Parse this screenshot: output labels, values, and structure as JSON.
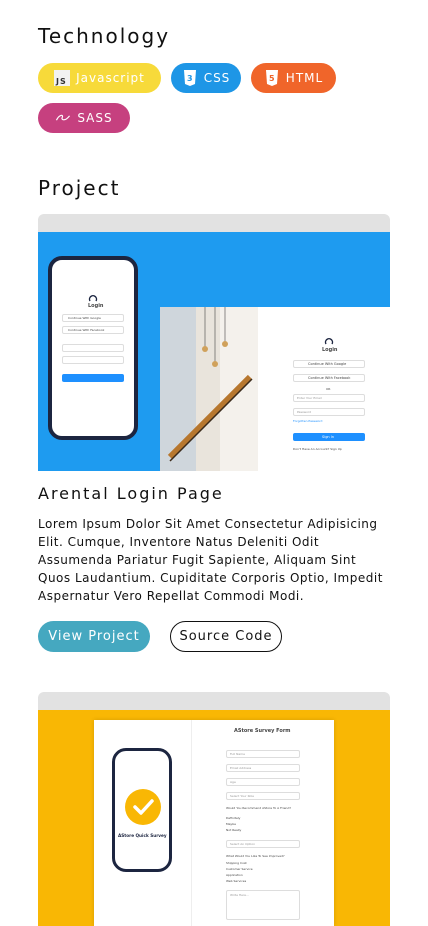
{
  "technology": {
    "title": "Technology",
    "badges": [
      {
        "label": "Javascript",
        "icon": "js-icon",
        "color": "#F7DA3A"
      },
      {
        "label": "CSS",
        "icon": "css3-icon",
        "color": "#1E96E6"
      },
      {
        "label": "HTML",
        "icon": "html5-icon",
        "color": "#F0652A"
      },
      {
        "label": "SASS",
        "icon": "sass-icon",
        "color": "#C6407F"
      }
    ]
  },
  "project": {
    "title": "Project",
    "items": [
      {
        "name": "Arental Login Page",
        "description": "Lorem Ipsum Dolor Sit Amet Consectetur Adipisicing Elit. Cumque, Inventore Natus Deleniti Odit Assumenda Pariatur Fugit Sapiente, Aliquam Sint Quos Laudantium. Cupiditate Corporis Optio, Impedit Aspernatur Vero Repellat Commodi Modi.",
        "view_label": "View Project",
        "source_label": "Source Code",
        "preview": {
          "bg": "#1E9BF0",
          "login_label": "Login",
          "google_label": "Continue With Google",
          "facebook_label": "Continue With Facebook",
          "or_label": "OR",
          "email_placeholder": "Enter Your Email",
          "password_placeholder": "Password",
          "forgot_label": "Forgotten Password",
          "signin_label": "Sign In",
          "signup_prompt": "Don't Have An Account? Sign Up"
        }
      },
      {
        "preview": {
          "bg": "#F9B704",
          "form_title": "AStore Survey Form",
          "quick_label": "AStore Quick Survey",
          "fields": [
            "Full Name",
            "Email Address",
            "Age",
            "Select Your Role"
          ],
          "question1": "Would You Recommend AStore To A Friend?",
          "options1": [
            "Definitely",
            "Maybe",
            "Not Really"
          ],
          "select_option": "Select An Option",
          "question2": "What Would You Like To See Improved?",
          "options2": [
            "Shipping Cost",
            "Customer Service",
            "Application",
            "Web Services"
          ],
          "textarea_placeholder": "Write Here..."
        }
      }
    ]
  }
}
